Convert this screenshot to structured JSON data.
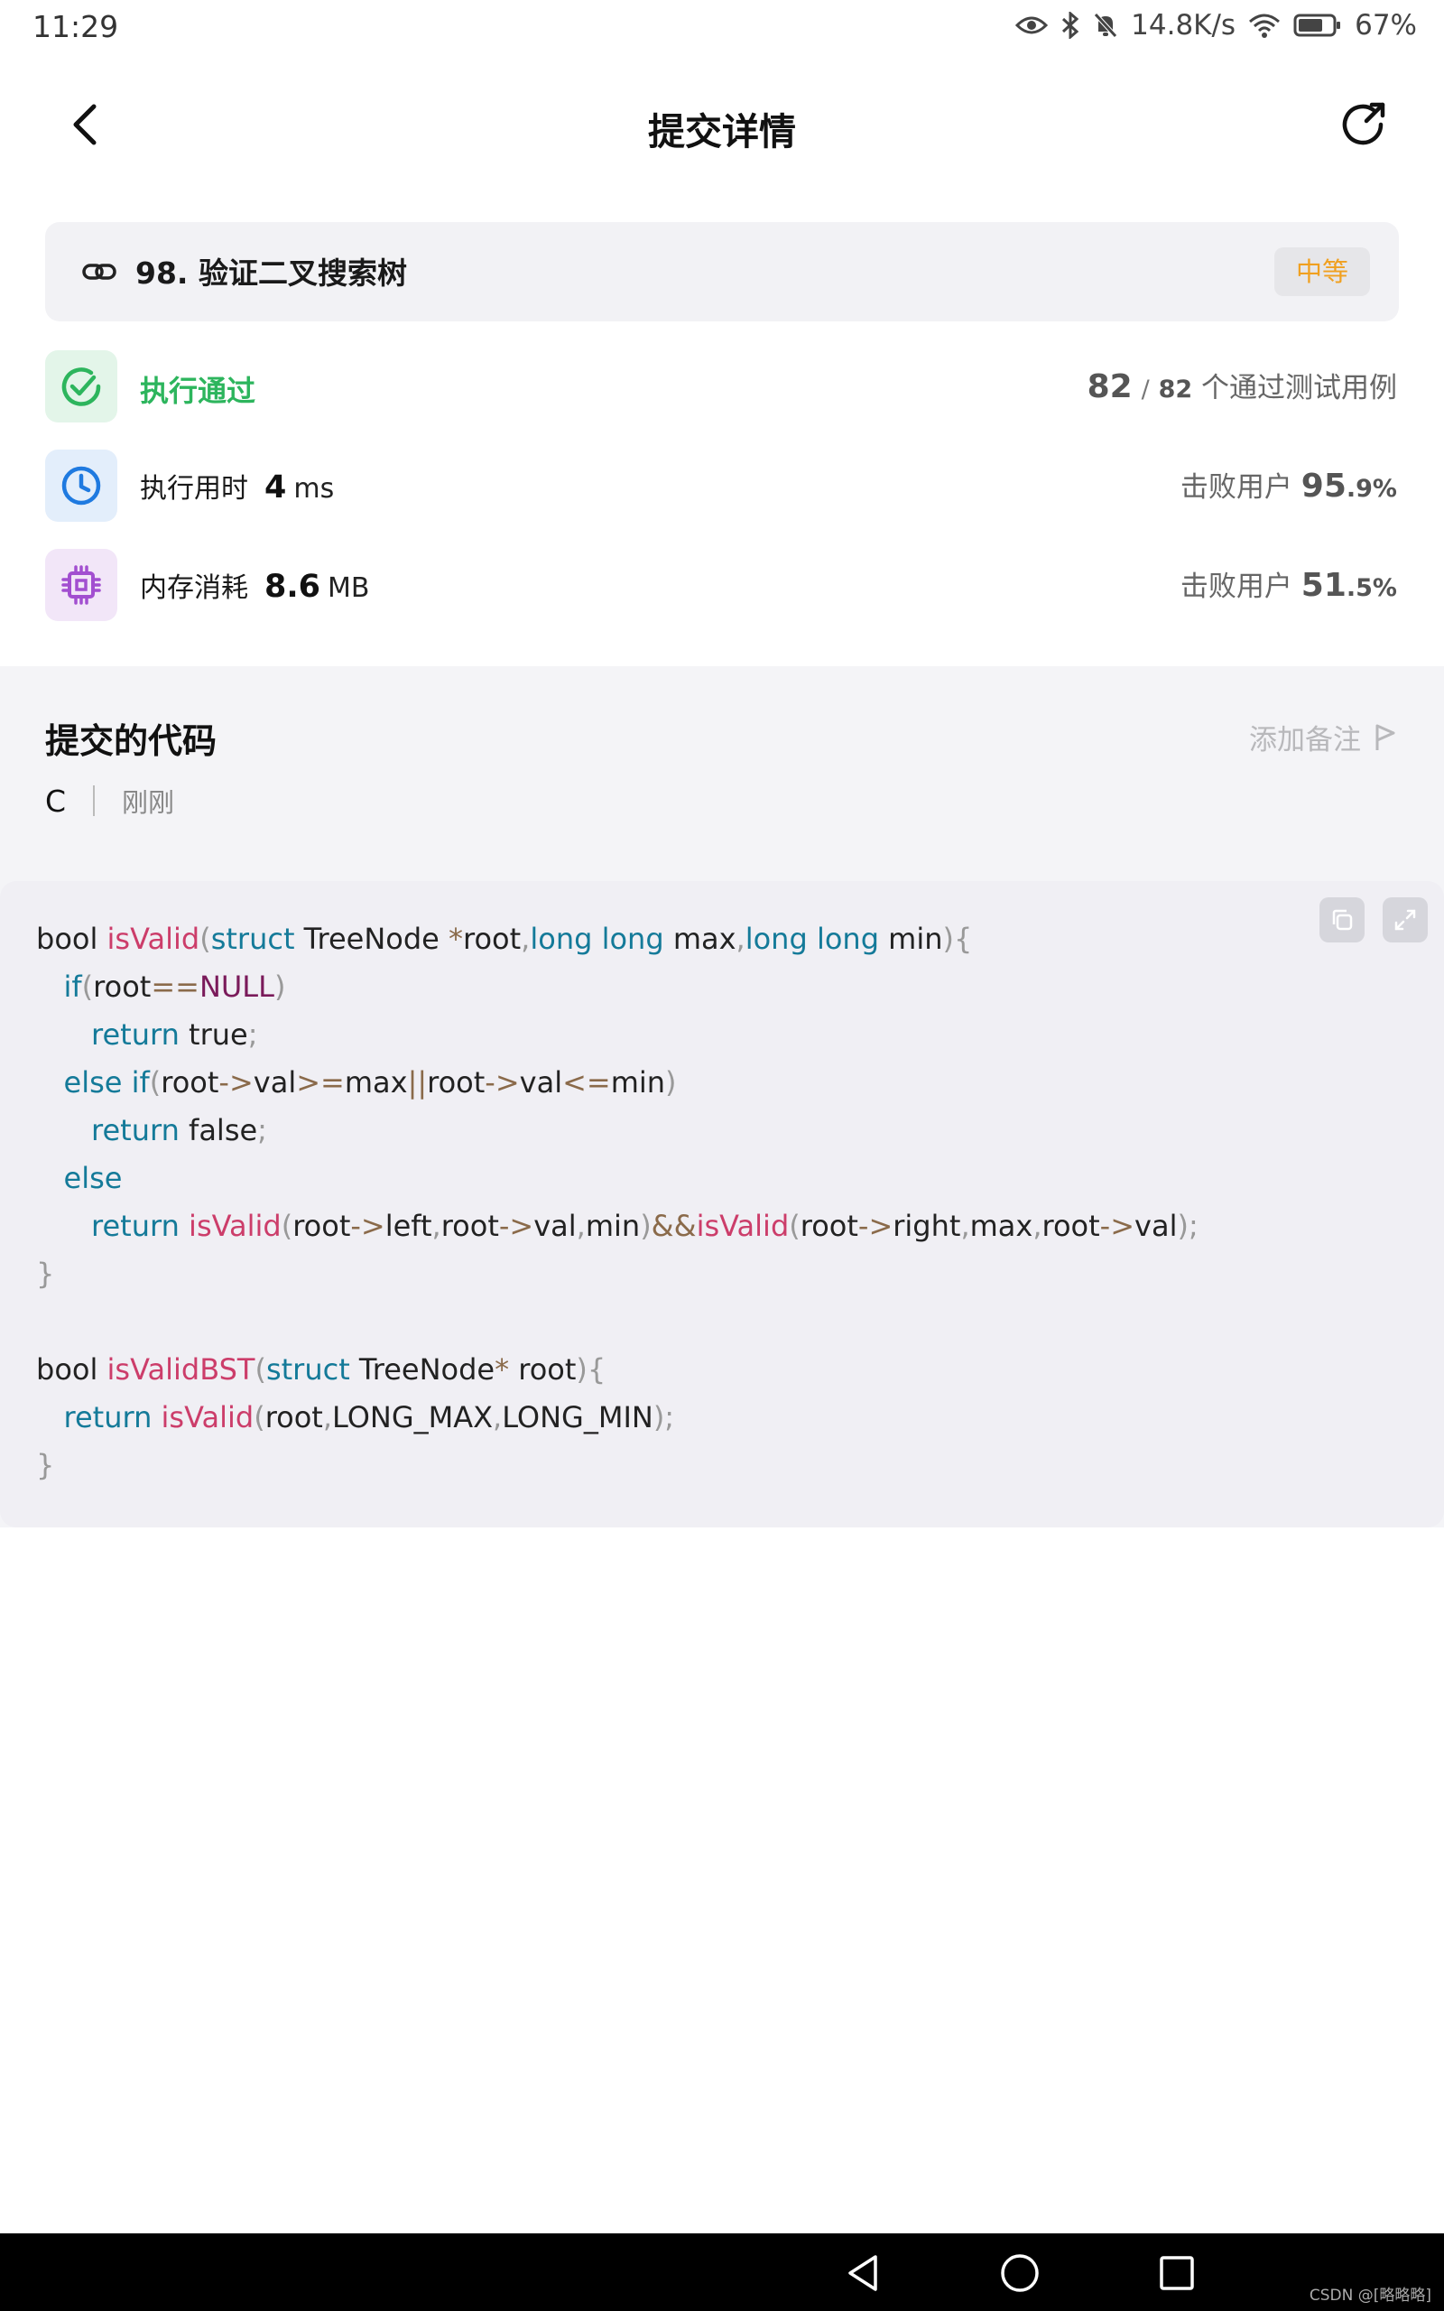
{
  "status_bar": {
    "time": "11:29",
    "network_speed": "14.8K/s",
    "battery": "67%",
    "icons": [
      "eye-icon",
      "bluetooth-icon",
      "mute-icon",
      "wifi-icon",
      "battery-icon"
    ]
  },
  "header": {
    "title": "提交详情"
  },
  "problem": {
    "title": "98. 验证二叉搜索树",
    "difficulty": "中等",
    "difficulty_color": "#f0a020"
  },
  "result": {
    "status": "执行通过",
    "status_color": "#2db55d",
    "passed": "82",
    "slash": "/",
    "total": "82",
    "passed_suffix": "个通过测试用例"
  },
  "runtime": {
    "label": "执行用时",
    "value": "4",
    "unit": "ms",
    "beats_label": "击败用户",
    "beats_major": "95",
    "beats_minor": ".9%"
  },
  "memory": {
    "label": "内存消耗",
    "value": "8.6",
    "unit": "MB",
    "beats_label": "击败用户",
    "beats_major": "51",
    "beats_minor": ".5%"
  },
  "code_section": {
    "title": "提交的代码",
    "add_note": "添加备注",
    "language": "C",
    "time": "刚刚"
  },
  "code_lines": [
    "bool isValid(struct TreeNode *root,long long max,long long min){",
    "   if(root==NULL)",
    "      return true;",
    "   else if(root->val>=max||root->val<=min)",
    "      return false;",
    "   else",
    "      return isValid(root->left,root->val,min)&&isValid(root->right,max,root->val);",
    "}",
    "",
    "bool isValidBST(struct TreeNode* root){",
    "   return isValid(root,LONG_MAX,LONG_MIN);",
    "}"
  ],
  "watermark": "CSDN @[略略略]"
}
